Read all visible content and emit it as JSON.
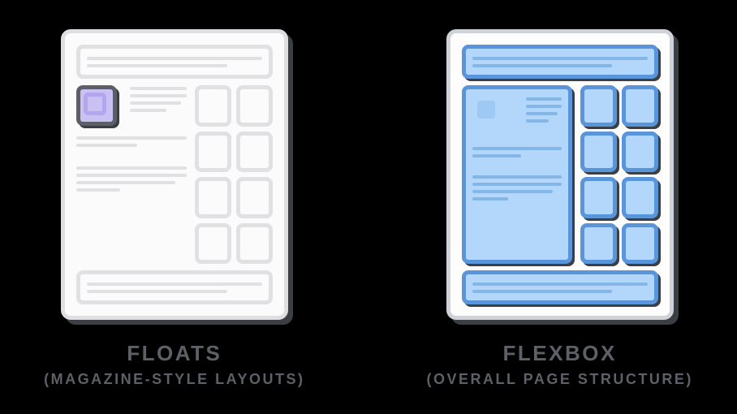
{
  "panels": {
    "floats": {
      "title": "FLOATS",
      "subtitle": "(MAGAZINE-STYLE LAYOUTS)"
    },
    "flexbox": {
      "title": "FLEXBOX",
      "subtitle": "(OVERALL PAGE STRUCTURE)"
    }
  },
  "colors": {
    "grey_border": "#e1e1e4",
    "blue_border": "#5995da",
    "blue_fill": "#b3d6fb",
    "purple_fill": "#c9c1f2",
    "dark": "#3b3f44"
  }
}
